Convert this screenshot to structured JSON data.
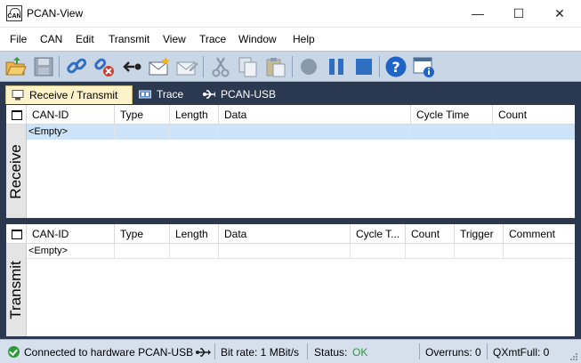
{
  "window": {
    "title": "PCAN-View",
    "app_icon_text": "CAN",
    "minimize": "—",
    "maximize": "☐",
    "close": "✕"
  },
  "menu": [
    "File",
    "CAN",
    "Edit",
    "Transmit",
    "View",
    "Trace",
    "Window",
    "Help"
  ],
  "toolbar": {
    "icons": [
      "open-folder-icon",
      "save-icon",
      "connect-icon",
      "disconnect-icon",
      "reset-icon",
      "new-message-icon",
      "edit-message-icon",
      "cut-icon",
      "copy-icon",
      "paste-icon",
      "record-icon",
      "pause-icon",
      "stop-icon",
      "help-icon",
      "about-icon"
    ],
    "accent": "#c9d6e6"
  },
  "tabs": [
    "Receive / Transmit",
    "Trace",
    "PCAN-USB"
  ],
  "receive": {
    "label": "Receive",
    "columns": [
      "CAN-ID",
      "Type",
      "Length",
      "Data",
      "Cycle Time",
      "Count"
    ],
    "rows": [
      {
        "can_id": "<Empty>"
      }
    ]
  },
  "transmit": {
    "label": "Transmit",
    "columns": [
      "CAN-ID",
      "Type",
      "Length",
      "Data",
      "Cycle T...",
      "Count",
      "Trigger",
      "Comment"
    ],
    "rows": [
      {
        "can_id": "<Empty>"
      }
    ]
  },
  "status": {
    "connection": "Connected to hardware PCAN-USB",
    "bitrate": "Bit rate: 1 MBit/s",
    "status_label": "Status:",
    "status_value": "OK",
    "overruns": "Overruns: 0",
    "qxmtfull": "QXmtFull: 0",
    "ok_color": "#2e9a3c"
  }
}
